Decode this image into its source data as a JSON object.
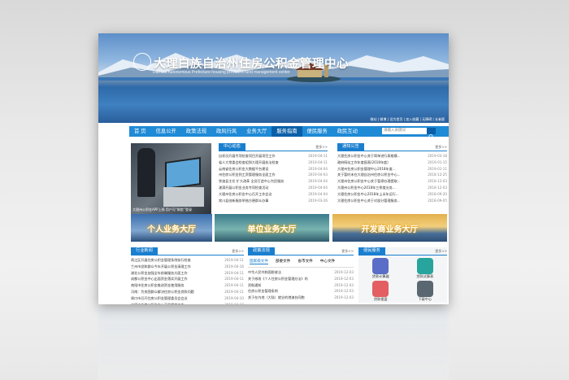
{
  "header": {
    "title": "大理白族自治州住房公积金管理中心",
    "subtitle": "Dali Bai Autonomous Prefecture housing provident fund management center",
    "top_links": "微站 | 微博 | 设为首页 | 加入收藏 | 无障碍 | 长者版"
  },
  "nav": {
    "items": [
      "首 页",
      "信息公开",
      "政策法规",
      "政风行风",
      "业务大厅",
      "服务指南",
      "便民服务",
      "政民互动"
    ],
    "search_placeholder": "请输入关键词"
  },
  "news_center": {
    "title": "中心动态",
    "more": "更多>>",
    "items": [
      {
        "t": "自状况开展专项检查项目开展项目工作",
        "d": "2019-04-11"
      },
      {
        "t": "省人大常委会检查组到大理开展执法检查",
        "d": "2019-04-11"
      },
      {
        "t": "云南省住房公积金大数据平台建设",
        "d": "2019-04-04"
      },
      {
        "t": "州住房公积金到工资管理服务全面工作",
        "d": "2019-04-03"
      },
      {
        "t": "弥渡县主任 扩大改革 全员打造中心为民服务",
        "d": "2019-04-04"
      },
      {
        "t": "漾濞开展公积金业务专项检查活动",
        "d": "2019-04-04"
      },
      {
        "t": "大理州住房公积金中心召开工作会议",
        "d": "2019-04-04"
      },
      {
        "t": "宾川县创新服务举措方便群众办事",
        "d": "2019-03-26"
      }
    ],
    "photo_caption": "大理州公积金APP上线  用户可“刷脸”登录"
  },
  "notices": {
    "title": "通知公告",
    "more": "更多>>",
    "items": [
      {
        "t": "大理住房公积金中心关于简单进行表格模...",
        "d": "2019-03-18"
      },
      {
        "t": "政府网站工作年度报表(2018年度)",
        "d": "2019-01-15"
      },
      {
        "t": "大理州住房公积金管理中心2018年度...",
        "d": "2019-01-11"
      },
      {
        "t": "关于暂时未在大理自治州住房公积金中心...",
        "d": "2018-12-25"
      },
      {
        "t": "大理州住房公积金中心关于暂停办理提取...",
        "d": "2018-12-03"
      },
      {
        "t": "大理州公积金中心2018年三季度业务...",
        "d": "2018-12-03"
      },
      {
        "t": "大理住房公积金中心2018年上半年运行...",
        "d": "2018-09-20"
      },
      {
        "t": "大理住房公积金中心关于对部分管理服务...",
        "d": "2018-09-05"
      }
    ]
  },
  "tiles": {
    "personal": "个人业务大厅",
    "unit": "单位业务大厅",
    "developer": "开发商业务大厅"
  },
  "industry": {
    "title": "行业新闻",
    "more": "更多>>",
    "items": [
      {
        "t": "两江区开展住房公积金管理条例执行检查",
        "d": "2019-04-11"
      },
      {
        "t": "兰州市党和群众今年开展公积金清理工作",
        "d": "2019-04-16"
      },
      {
        "t": "湖北公积金加强全年前端服务方面工作",
        "d": "2019-04-11"
      },
      {
        "t": "成都公积金中心出面资金落实开展工作",
        "d": "2019-04-11"
      },
      {
        "t": "南阳市住房公积金推进资金使用服务",
        "d": "2019-04-11"
      },
      {
        "t": "河南：为贫困群众解决住房公积金贷款问题",
        "d": "2019-04-11"
      },
      {
        "t": "周口市召开住房公积金管理委员会会议",
        "d": "2019-04-10"
      },
      {
        "t": "太原市住房公积金中心开展相关工作",
        "d": "2019-04-10"
      },
      {
        "t": "南京市住房公积金管理中心优化流程服务",
        "d": "2019-03-26"
      }
    ]
  },
  "policy": {
    "title": "政策法规",
    "more": "更多>>",
    "tabs": [
      "国家级文件",
      "部委文件",
      "省市文件",
      "中心文件"
    ],
    "items": [
      {
        "t": "中华人民共和国税收法",
        "d": "2019-12-03"
      },
      {
        "t": "关于修改《个人住房公积金管理办法》的",
        "d": "2019-12-03"
      },
      {
        "t": "资助通知",
        "d": "2019-12-03"
      },
      {
        "t": "住房公积金管理条例",
        "d": "2019-12-03"
      },
      {
        "t": "关于在内地（大陆）就业的港澳台同胞",
        "d": "2019-12-03"
      }
    ]
  },
  "services": {
    "title": "便民服务",
    "more": "更多>>",
    "items": [
      {
        "label": "贷款计算器",
        "color": "#5b6ec7",
        "icon": "calculator-icon"
      },
      {
        "label": "贷款试算表",
        "color": "#27a59c",
        "icon": "chart-icon"
      },
      {
        "label": "贷款楼盘",
        "color": "#e35f61",
        "icon": "building-icon"
      },
      {
        "label": "下载中心",
        "color": "#5b6770",
        "icon": "download-icon"
      }
    ]
  }
}
